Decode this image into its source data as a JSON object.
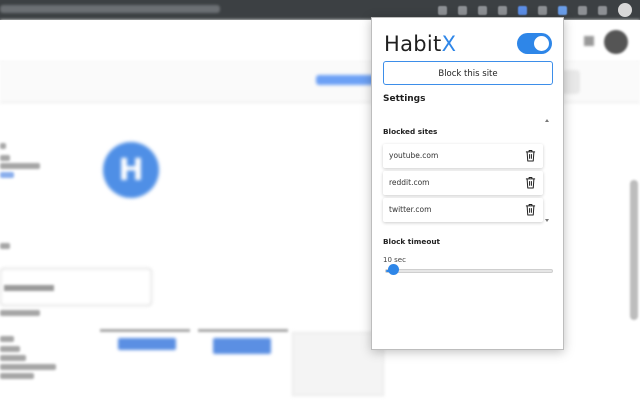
{
  "popup": {
    "brand": {
      "name": "Habit",
      "accent": "X",
      "accent_color": "#2e86e8"
    },
    "enabled_toggle": {
      "state": "on",
      "color": "#2e86e8"
    },
    "block_button_label": "Block this site",
    "settings_heading": "Settings",
    "blocked_sites": {
      "heading": "Blocked sites",
      "items": [
        {
          "label": "youtube.com",
          "icon": "trash-icon"
        },
        {
          "label": "reddit.com",
          "icon": "trash-icon"
        },
        {
          "label": "twitter.com",
          "icon": "trash-icon"
        }
      ]
    },
    "block_timeout": {
      "heading": "Block timeout",
      "value_label": "10 sec",
      "slider_fraction": 0.05
    }
  },
  "background": {
    "hint": "blurred webpage behind extension popup",
    "badge_letter": "H",
    "accent_color": "#4f8fe6"
  }
}
